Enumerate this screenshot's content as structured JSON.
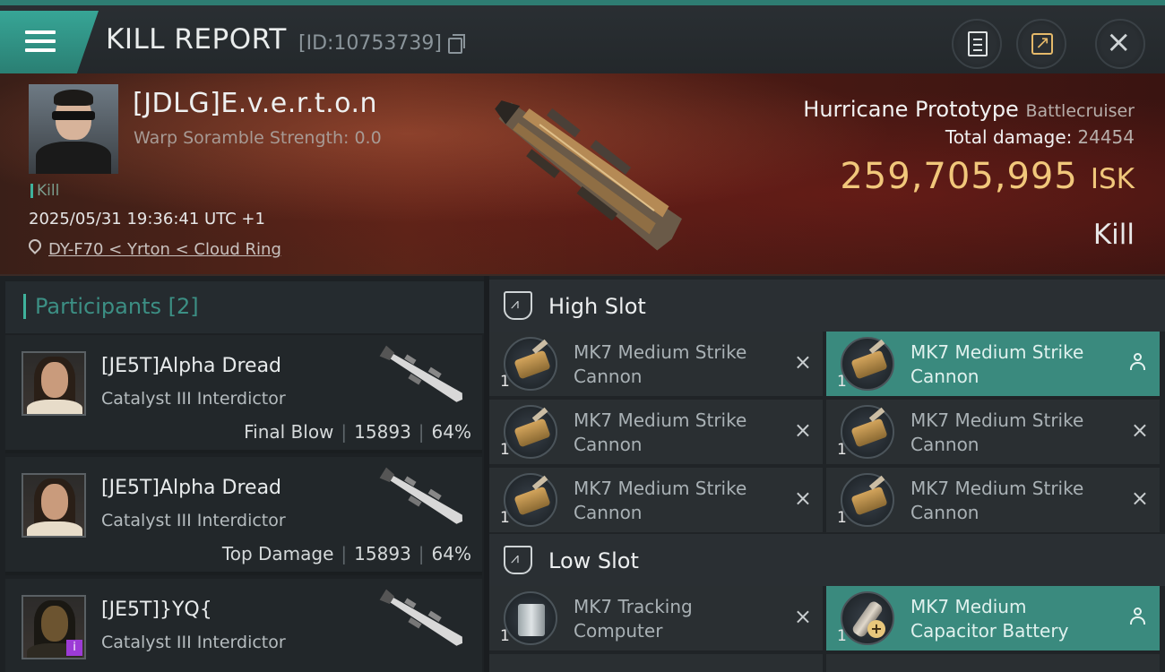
{
  "header": {
    "title": "KILL REPORT",
    "report_id": "[ID:10753739]"
  },
  "victim": {
    "name": "[JDLG]E.v.e.r.t.o.n",
    "warp_scramble": "Warp Soramble Strength: 0.0",
    "tag": "Kill",
    "datetime": "2025/05/31 19:36:41 UTC +1",
    "location": "DY-F70 < Yrton < Cloud Ring"
  },
  "loss": {
    "ship_name": "Hurricane Prototype",
    "ship_class": "Battlecruiser",
    "damage_label": "Total damage:",
    "damage_value": "24454",
    "isk_value": "259,705,995",
    "isk_unit": "ISK",
    "result": "Kill"
  },
  "participants": {
    "title": "Participants",
    "count": "[2]",
    "rows": [
      {
        "name": "[JE5T]Alpha Dread",
        "ship": "Catalyst III Interdictor",
        "role": "Final Blow",
        "damage": "15893",
        "percent": "64%"
      },
      {
        "name": "[JE5T]Alpha Dread",
        "ship": "Catalyst III Interdictor",
        "role": "Top Damage",
        "damage": "15893",
        "percent": "64%"
      },
      {
        "name": "[JE5T]}YQ{",
        "ship": "Catalyst III Interdictor",
        "badge": "i"
      }
    ]
  },
  "fitting": {
    "high_slot_title": "High Slot",
    "low_slot_title": "Low Slot",
    "high_modules": [
      {
        "name": "MK7 Medium Strike Cannon",
        "qty": "1",
        "icon": "cannon-icon"
      },
      {
        "name": "MK7 Medium Strike Cannon",
        "qty": "1",
        "icon": "cannon-icon"
      },
      {
        "name": "MK7 Medium Strike Cannon",
        "qty": "1",
        "icon": "cannon-icon"
      },
      {
        "name": "MK7 Medium Strike Cannon",
        "qty": "1",
        "icon": "cannon-icon"
      },
      {
        "name": "MK7 Medium Strike Cannon",
        "qty": "1",
        "icon": "cannon-icon"
      },
      {
        "name": "MK7 Medium Strike Cannon",
        "qty": "1",
        "icon": "cannon-icon"
      }
    ],
    "low_modules": [
      {
        "name": "MK7 Tracking Computer",
        "qty": "1",
        "icon": "tracking-computer-icon"
      },
      {
        "name": "MK7 Medium Capacitor Battery",
        "qty": "1",
        "icon": "capacitor-battery-icon"
      }
    ]
  },
  "colors": {
    "accent": "#3fb29c",
    "isk": "#f1c77b",
    "active_module": "#3a8a7e"
  },
  "icons": {
    "close": "×",
    "drop_action": "×"
  }
}
